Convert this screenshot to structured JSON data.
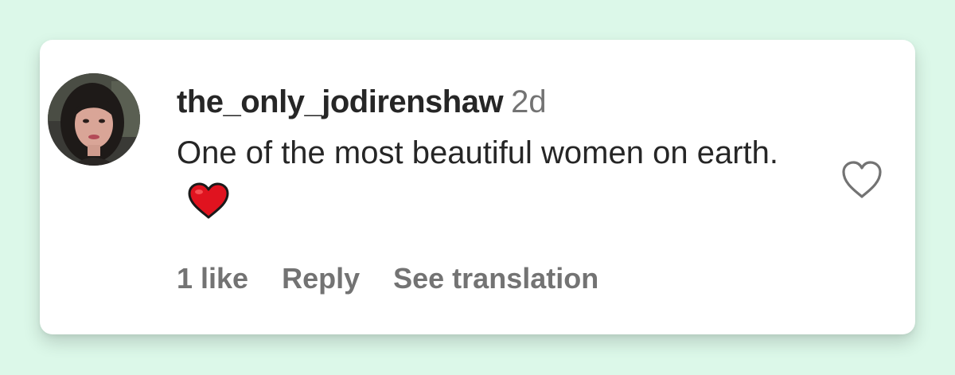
{
  "comment": {
    "username": "the_only_jodirenshaw",
    "timestamp": "2d",
    "text": "One of the most beautiful women on earth.",
    "emoji": "red-heart-emoji"
  },
  "actions": {
    "likes": "1 like",
    "reply": "Reply",
    "translate": "See translation"
  },
  "icons": {
    "like": "heart-outline-icon",
    "avatar": "profile-photo"
  },
  "colors": {
    "background": "#dcf8e9",
    "card": "#ffffff",
    "primary_text": "#262626",
    "secondary_text": "#737373",
    "heart_emoji": "#e0131f"
  }
}
